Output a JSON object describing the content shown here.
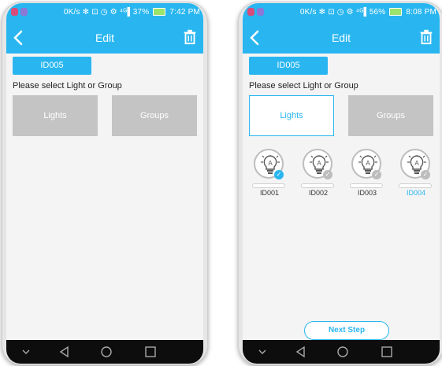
{
  "left_phone": {
    "status": {
      "text": "0K/s ✻ ⊡ ◷ ⚙ ⁴ᴳ▌37%",
      "time": "7:42 PM"
    },
    "appbar": {
      "title": "Edit"
    },
    "id_chip": "ID005",
    "prompt": "Please select Light or Group",
    "tiles": {
      "lights": "Lights",
      "groups": "Groups"
    },
    "selected_tile": "none"
  },
  "right_phone": {
    "status": {
      "text": "0K/s ✻ ⊡ ◷ ⚙ ⁴ᴳ▌56%",
      "time": "8:08 PM"
    },
    "appbar": {
      "title": "Edit"
    },
    "id_chip": "ID005",
    "prompt": "Please select Light or Group",
    "tiles": {
      "lights": "Lights",
      "groups": "Groups"
    },
    "selected_tile": "lights",
    "lights": [
      {
        "label": "ID001",
        "checked": true
      },
      {
        "label": "ID002",
        "checked": false
      },
      {
        "label": "ID003",
        "checked": false
      },
      {
        "label": "ID004",
        "checked": false,
        "highlighted": true
      }
    ],
    "next_step_label": "Next Step"
  },
  "icons": {
    "back": "chevron-left-icon",
    "trash": "trash-icon",
    "bulb": "lightbulb-icon",
    "nav": [
      "chevron-down-icon",
      "triangle-back-icon",
      "circle-home-icon",
      "square-recents-icon"
    ]
  },
  "colors": {
    "accent": "#29b6f0",
    "tile_gray": "#c4c4c4",
    "check_selected": "#29b6f0",
    "check_unselected": "#bdbdbd",
    "nav_background": "#0d0d0d"
  }
}
